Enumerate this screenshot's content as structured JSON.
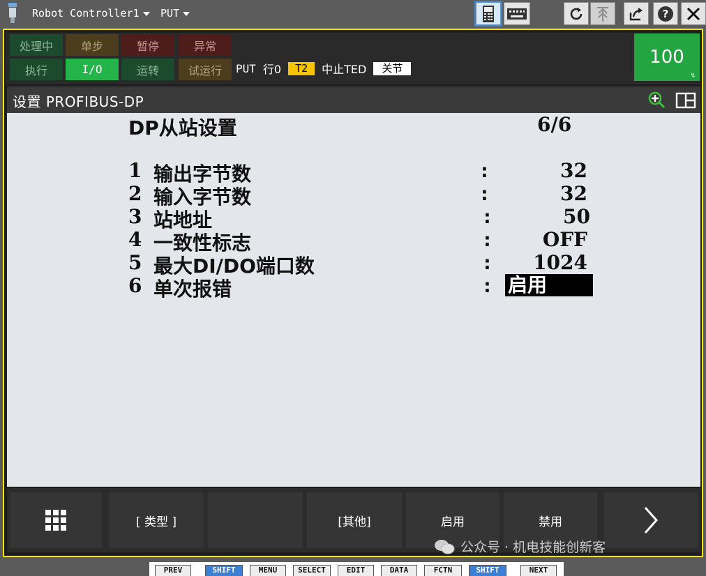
{
  "titlebar": {
    "controller": "Robot Controller1",
    "program": "PUT"
  },
  "status": {
    "processing": "处理中",
    "single_step": "单步",
    "hold": "暂停",
    "fault": "异常",
    "run": "执行",
    "io": "I/O",
    "operation": "运转",
    "test_run": "试运行",
    "program": "PUT",
    "line": "行0",
    "mode": "T2",
    "state": "中止TED",
    "coord": "关节",
    "override": "100"
  },
  "screen": {
    "title": "设置 PROFIBUS-DP",
    "heading": "DP从站设置",
    "page": "6/6",
    "items": [
      {
        "num": "1",
        "label": "输出字节数",
        "value": "32"
      },
      {
        "num": "2",
        "label": "输入字节数",
        "value": "32"
      },
      {
        "num": "3",
        "label": "站地址",
        "value": "50"
      },
      {
        "num": "4",
        "label": "一致性标志",
        "value": "OFF"
      },
      {
        "num": "5",
        "label": "最大DI/DO端口数",
        "value": "1024"
      },
      {
        "num": "6",
        "label": "单次报错",
        "value": "启用"
      }
    ]
  },
  "fkeys": {
    "f1": "[ 类型 ]",
    "f3": "[其他]",
    "f4": "启用",
    "f5": "禁用"
  },
  "watermark": "公众号 · 机电技能创新客",
  "hardkeys": [
    "PREV",
    "SHIFT",
    "MENU",
    "SELECT",
    "EDIT",
    "DATA",
    "FCTN",
    "SHIFT",
    "NEXT"
  ]
}
